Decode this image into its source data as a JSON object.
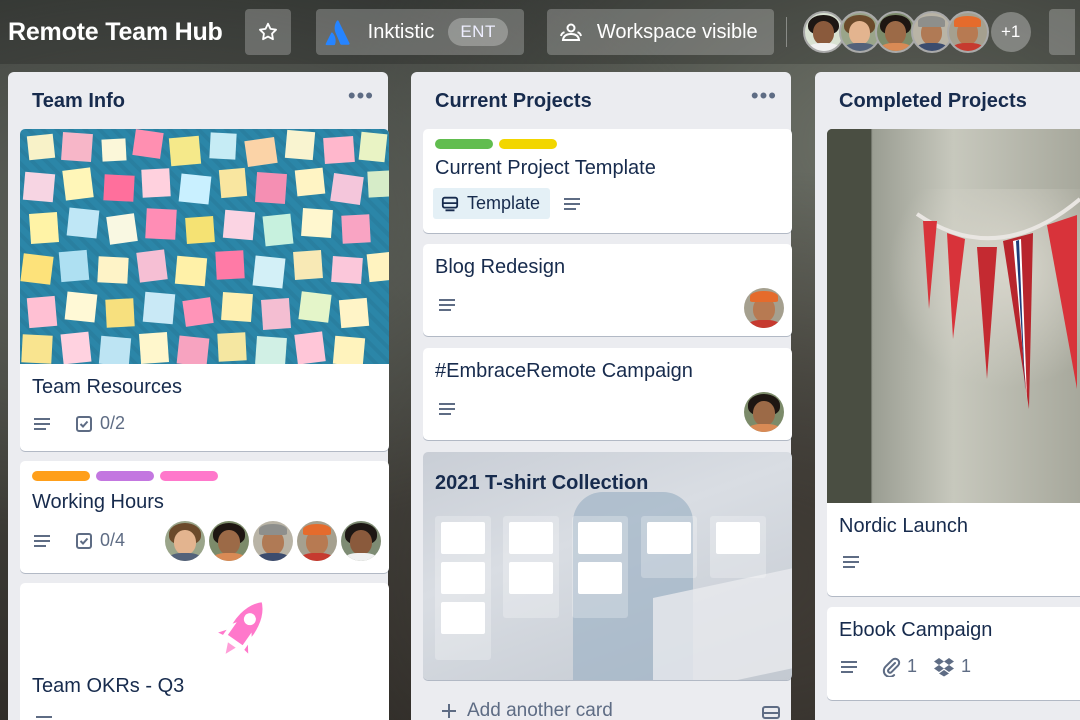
{
  "header": {
    "board_title": "Remote Team Hub",
    "workspace_name": "Inktistic",
    "workspace_badge": "ENT",
    "visibility_label": "Workspace visible",
    "extra_members": "+1"
  },
  "colors": {
    "green": "#61bd4f",
    "yellow": "#f2d600",
    "orange": "#ff9f1a",
    "purple": "#c377e0",
    "pink": "#ff78cb",
    "atlassian_blue": "#2684ff"
  },
  "lists": [
    {
      "title": "Team Info",
      "cards": [
        {
          "title": "Team Resources",
          "checklist": "0/2"
        },
        {
          "title": "Working Hours",
          "checklist": "0/4"
        },
        {
          "title": "Team OKRs - Q3"
        }
      ]
    },
    {
      "title": "Current Projects",
      "cards": [
        {
          "title": "Current Project Template",
          "template_label": "Template"
        },
        {
          "title": "Blog Redesign"
        },
        {
          "title": "#EmbraceRemote Campaign"
        },
        {
          "title": "2021 T-shirt Collection"
        }
      ],
      "add_card_label": "Add another card"
    },
    {
      "title": "Completed Projects",
      "cards": [
        {
          "title": "Nordic Launch"
        },
        {
          "title": "Ebook Campaign",
          "attachments": "1",
          "dropbox": "1"
        }
      ]
    }
  ]
}
